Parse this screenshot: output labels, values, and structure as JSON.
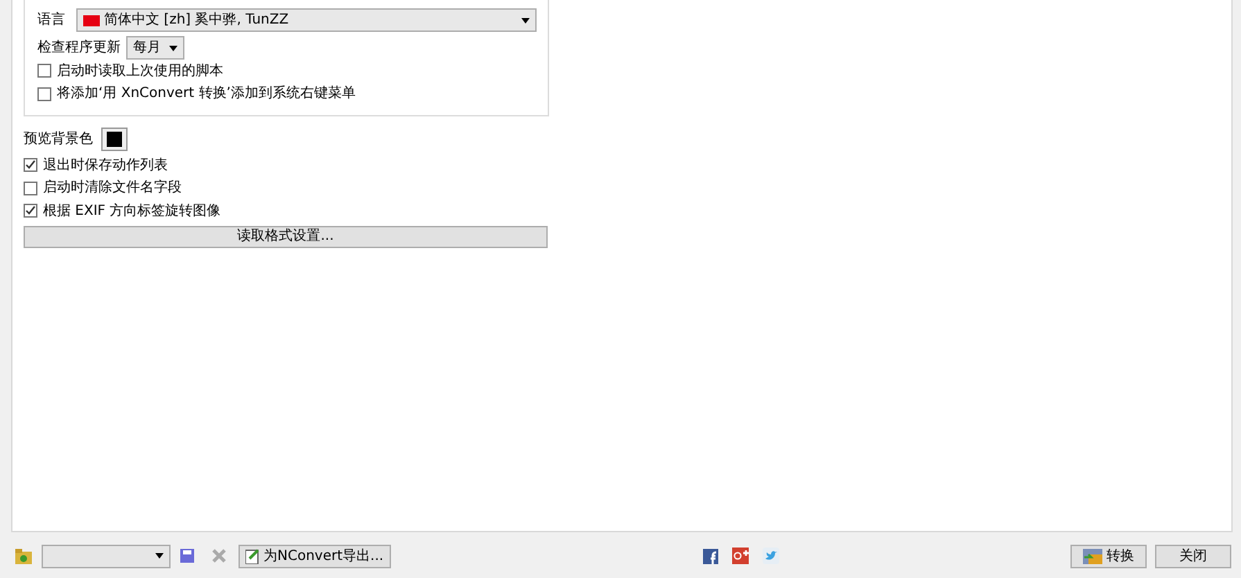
{
  "general_group": {
    "language": {
      "label": "语言",
      "value": "简体中文 [zh] 奚中骅, TunZZ"
    },
    "update_check": {
      "label": "检查程序更新",
      "value": "每月"
    },
    "options": [
      {
        "label": "启动时读取上次使用的脚本",
        "checked": false
      },
      {
        "label": "将添加‘用 XnConvert 转换’添加到系统右键菜单",
        "checked": false
      }
    ]
  },
  "preview_background": {
    "label": "预览背景色",
    "color": "#000000"
  },
  "options": [
    {
      "label": "退出时保存动作列表",
      "checked": true
    },
    {
      "label": "启动时清除文件名字段",
      "checked": false
    },
    {
      "label": "根据 EXIF 方向标签旋转图像",
      "checked": true
    }
  ],
  "read_format_button": "读取格式设置...",
  "footer": {
    "export_button": "为NConvert导出...",
    "convert_button": "转换",
    "close_button": "关闭"
  }
}
